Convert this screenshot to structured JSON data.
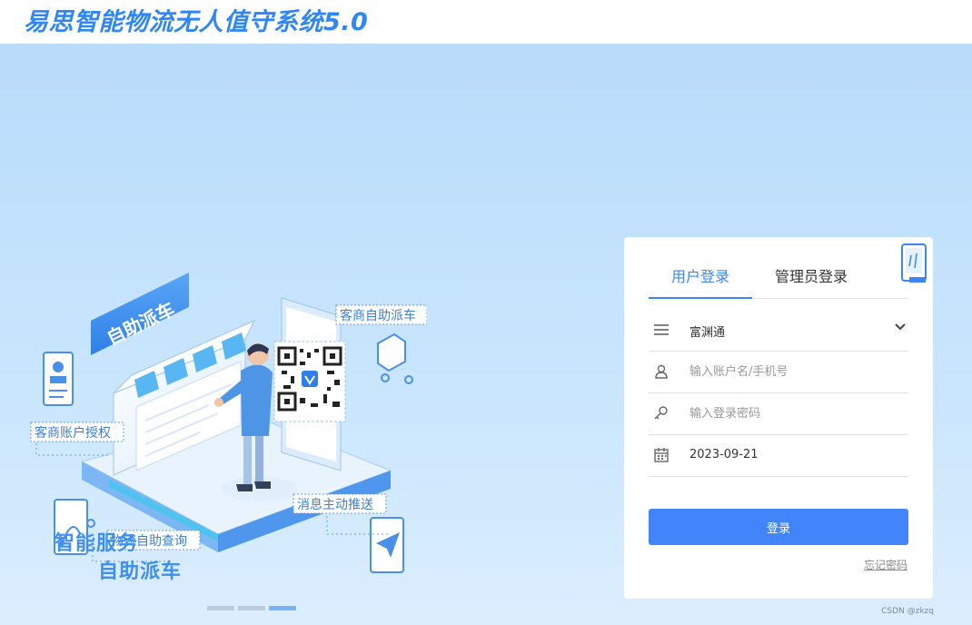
{
  "header": {
    "title": "易思智能物流无人值守系统5.0"
  },
  "illustration": {
    "sign_text": "自助派车",
    "callouts": {
      "merchant_dispatch": "客商自助派车",
      "account_auth": "客商账户授权",
      "message_push": "消息主动推送",
      "logistics_query": "物流自助查询"
    },
    "slogan_line1": "智能服务",
    "slogan_line2": "自助派车",
    "carousel": {
      "count": 3,
      "active_index": 2
    }
  },
  "login": {
    "tabs": [
      {
        "label": "用户登录",
        "active": true
      },
      {
        "label": "管理员登录",
        "active": false
      }
    ],
    "company_select": {
      "value": "富渊通",
      "icon": "menu-icon"
    },
    "username": {
      "placeholder": "输入账户名/手机号",
      "value": "",
      "icon": "user-icon"
    },
    "password": {
      "placeholder": "输入登录密码",
      "value": "",
      "icon": "key-icon"
    },
    "date": {
      "value": "2023-09-21",
      "icon": "calendar-icon"
    },
    "submit_label": "登录",
    "forgot_label": "忘记密码"
  },
  "watermark": "CSDN @zkzq",
  "colors": {
    "brand": "#2f86f5",
    "button": "#4285fa",
    "tab_active": "#3c86f4",
    "background_top": "#b9dcfb",
    "background_bottom": "#dbeefe"
  }
}
